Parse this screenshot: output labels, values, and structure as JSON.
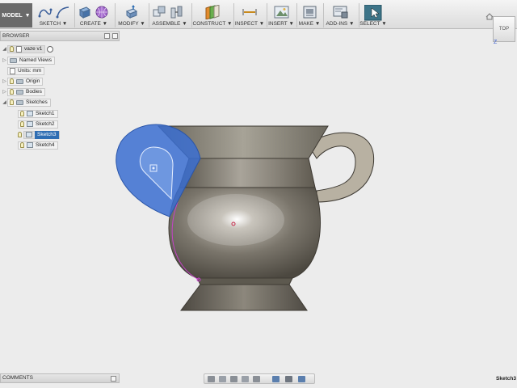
{
  "toolbar": {
    "workspace": "MODEL",
    "groups": [
      {
        "label": "SKETCH"
      },
      {
        "label": "CREATE"
      },
      {
        "label": "MODIFY"
      },
      {
        "label": "ASSEMBLE"
      },
      {
        "label": "CONSTRUCT"
      },
      {
        "label": "INSPECT"
      },
      {
        "label": "INSERT"
      },
      {
        "label": "MAKE"
      },
      {
        "label": "ADD-INS"
      },
      {
        "label": "SELECT"
      }
    ],
    "dropdown_arrow": "▼"
  },
  "browser": {
    "title": "BROWSER",
    "root": "vaze v1",
    "items": [
      {
        "label": "Named Views"
      },
      {
        "label": "Units: mm"
      },
      {
        "label": "Origin"
      },
      {
        "label": "Bodies"
      },
      {
        "label": "Sketches"
      }
    ],
    "sketches": [
      {
        "label": "Sketch1"
      },
      {
        "label": "Sketch2"
      },
      {
        "label": "Sketch3",
        "selected": true
      },
      {
        "label": "Sketch4"
      }
    ]
  },
  "viewcube": {
    "face": "TOP",
    "axis_label": "Z"
  },
  "comments": {
    "title": "COMMENTS"
  },
  "status": {
    "active_sketch": "Sketch3"
  },
  "colors": {
    "selection": "#2f6eb3",
    "body_metal": "#6f6a60",
    "profile_blue": "#3b6fd1"
  }
}
